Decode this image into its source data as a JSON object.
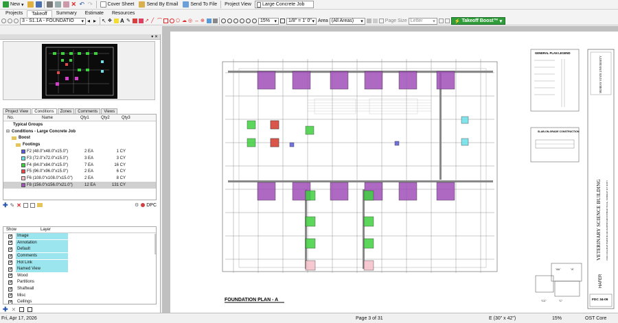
{
  "toolbar": {
    "new_label": "New",
    "cover_sheet_label": "Cover Sheet",
    "send_email_label": "Send By Email",
    "send_file_label": "Send To File",
    "project_view_label": "Project View",
    "project_name": "Large Concrete Job"
  },
  "menu_tabs": [
    "Projects",
    "Takeoff",
    "Summary",
    "Estimate",
    "Resources"
  ],
  "page_toolbar": {
    "page_select": "3 - S1.1A - FOUNDATIO",
    "zoom": "15%",
    "scale": "1/8\" = 1' 0\"",
    "area_label": "Area",
    "area_value": "(All Areas)",
    "page_size_label": "Page Size",
    "page_size_value": "Letter",
    "boost_label": "Takeoff Boost™"
  },
  "panel_tabs": [
    "Project View",
    "Conditions",
    "Zones",
    "Comments",
    "Views"
  ],
  "conditions": {
    "columns": [
      "No.",
      "Name",
      "Qty1",
      "Qty2",
      "Qty3"
    ],
    "group_typical": "Typical Groups",
    "group_job": "Conditions - Large Concrete Job",
    "group_boost": "Boost",
    "group_footings": "Footings",
    "rows": [
      {
        "name": "F2 (48.0\"x48.0\"x15.0\")",
        "qty1": "2 EA",
        "qty2": "1 CY",
        "color": "#5a5ad8"
      },
      {
        "name": "F3 (72.0\"x72.0\"x15.0\")",
        "qty1": "3 EA",
        "qty2": "3 CY",
        "color": "#6de0e8"
      },
      {
        "name": "F4 (84.0\"x84.0\"x15.0\")",
        "qty1": "7 EA",
        "qty2": "16 CY",
        "color": "#3fd03f"
      },
      {
        "name": "F5 (96.0\"x96.0\"x15.0\")",
        "qty1": "2 EA",
        "qty2": "6 CY",
        "color": "#e84848"
      },
      {
        "name": "F6 (108.0\"x108.0\"x15.0\")",
        "qty1": "2 EA",
        "qty2": "8 CY",
        "color": "#f4c0c8"
      },
      {
        "name": "F8 (156.0\"x156.0\"x21.0\")",
        "qty1": "12 EA",
        "qty2": "131 CY",
        "color": "#a050b8"
      }
    ],
    "dpc_label": "DPC"
  },
  "layers": {
    "columns": [
      "Show",
      "Layer"
    ],
    "rows": [
      {
        "name": "Image",
        "hl": true
      },
      {
        "name": "Annotation",
        "hl": true
      },
      {
        "name": "Default",
        "hl": true
      },
      {
        "name": "Comments",
        "hl": true
      },
      {
        "name": "Hot Link",
        "hl": true
      },
      {
        "name": "Named View",
        "hl": true
      },
      {
        "name": "Wood",
        "hl": false
      },
      {
        "name": "Partitions",
        "hl": false
      },
      {
        "name": "Shaftwall",
        "hl": false
      },
      {
        "name": "Misc",
        "hl": false
      },
      {
        "name": "Ceilings",
        "hl": false
      }
    ]
  },
  "drawing": {
    "plan_title": "FOUNDATION PLAN - A",
    "legend_title": "GENERAL PLAN LEGEND",
    "slab_title": "SLAB-ON-GRADE CONSTRUCTION",
    "building_name": "VETERINARY SCIENCE BUILDING",
    "building_address": "2100 COLLEGE FARM ROAD & RESEARCH FIELD TOOL, MURRAY KY 42071",
    "university": "MURRAY STATE UNIVERSITY",
    "architect": "HAFER",
    "sheet_no": "FDC 34-09",
    "key_a": "\"AA\"",
    "key_b": "\"A\"",
    "key_c": "\"C\"",
    "key_cc": "\"CC\""
  },
  "status": {
    "date": "Fri, Apr 17, 2026",
    "page": "Page 3 of 31",
    "sheet_size": "E (30\" x 42\")",
    "zoom": "15%",
    "app_name": "OST Core"
  },
  "colors": {
    "boost_green": "#2e9d3a",
    "layer_highlight": "#9be6ee",
    "f8_purple": "#a050b8",
    "f4_green": "#3fd03f"
  }
}
